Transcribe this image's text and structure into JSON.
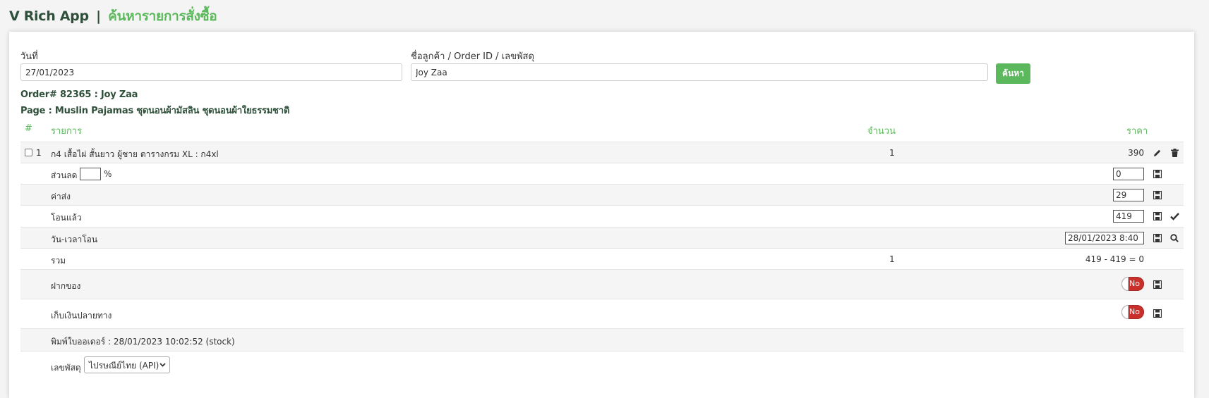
{
  "header": {
    "app_name": "V Rich App",
    "separator": "|",
    "page_title": "ค้นหารายการสั่งซื้อ"
  },
  "search": {
    "date_label": "วันที่",
    "date_value": "27/01/2023",
    "query_label": "ชื่อลูกค้า / Order ID / เลขพัสดุ",
    "query_value": "Joy Zaa",
    "button_label": "ค้นหา"
  },
  "order": {
    "title": "Order# 82365 : Joy Zaa",
    "page": "Page : Muslin Pajamas ชุดนอนผ้ามัสลิน ชุดนอนผ้าใยธรรมชาติ"
  },
  "table": {
    "headers": {
      "index": "#",
      "item": "รายการ",
      "qty": "จำนวน",
      "price": "ราคา"
    },
    "item": {
      "index": "1",
      "name": "ก4 เสื้อไผ่ สั้นยาว ผู้ชาย ตารางกรม XL : ก4xl",
      "qty": "1",
      "price": "390"
    },
    "discount": {
      "label": "ส่วนลด",
      "percent_value": "",
      "percent_sign": "%",
      "value": "0"
    },
    "shipping": {
      "label": "ค่าส่ง",
      "value": "29"
    },
    "paid": {
      "label": "โอนแล้ว",
      "value": "419"
    },
    "paid_datetime": {
      "label": "วัน-เวลาโอน",
      "value": "28/01/2023 8:40"
    },
    "total": {
      "label": "รวม",
      "qty": "1",
      "value": "419 - 419 = 0"
    },
    "deposit": {
      "label": "ฝากของ",
      "toggle": "No"
    },
    "cod": {
      "label": "เก็บเงินปลายทาง",
      "toggle": "No"
    },
    "printed": {
      "text": "พิมพ์ใบออเดอร์ : 28/01/2023 10:02:52 (stock)"
    },
    "tracking": {
      "label": "เลขพัสดุ",
      "carrier": "ไปรษณีย์ไทย (API)"
    }
  },
  "colors": {
    "accent": "#5cb85c",
    "danger": "#c9302c",
    "heading": "#2f4f3a"
  }
}
